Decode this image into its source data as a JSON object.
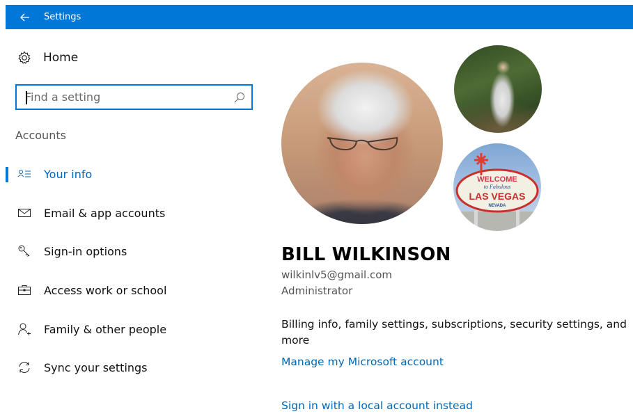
{
  "window": {
    "title": "Settings",
    "back_icon": "back-arrow-icon"
  },
  "colors": {
    "accent": "#0078d7",
    "link": "#0067b8",
    "titlebar_text": "#ffffff"
  },
  "sidebar": {
    "home_label": "Home",
    "home_icon": "gear-icon",
    "search_placeholder": "Find a setting",
    "search_icon": "search-icon",
    "section_label": "Accounts",
    "items": [
      {
        "label": "Your info",
        "icon": "person-list-icon",
        "active": true
      },
      {
        "label": "Email & app accounts",
        "icon": "mail-icon",
        "active": false
      },
      {
        "label": "Sign-in options",
        "icon": "key-icon",
        "active": false
      },
      {
        "label": "Access work or school",
        "icon": "briefcase-icon",
        "active": false
      },
      {
        "label": "Family & other people",
        "icon": "person-add-icon",
        "active": false
      },
      {
        "label": "Sync your settings",
        "icon": "sync-icon",
        "active": false
      }
    ]
  },
  "main": {
    "user_name": "BILL WILKINSON",
    "email": "wilkinlv5@gmail.com",
    "role": "Administrator",
    "billing_text": "Billing info, family settings, subscriptions, security settings, and more",
    "manage_link": "Manage my Microsoft account",
    "local_account_link": "Sign in with a local account instead",
    "photo_sign_lines": [
      "WELCOME",
      "to Fabulous",
      "LAS VEGAS",
      "NEVADA"
    ]
  }
}
